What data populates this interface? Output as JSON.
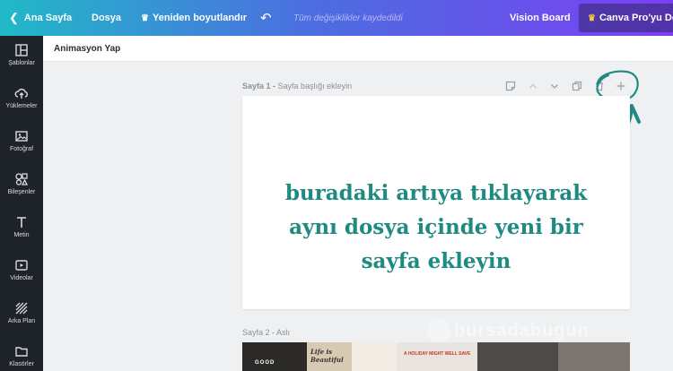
{
  "topbar": {
    "home_label": "Ana Sayfa",
    "file_label": "Dosya",
    "resize_label": "Yeniden boyutlandır",
    "status_text": "Tüm değişiklikler kaydedildi",
    "vision_label": "Vision Board",
    "pro_label": "Canva Pro'yu Den",
    "gradient_start": "#21b9c8",
    "gradient_end": "#7b3ff2"
  },
  "sidebar": {
    "items": [
      {
        "label": "Şablonlar",
        "icon": "layout-icon"
      },
      {
        "label": "Yüklemeler",
        "icon": "upload-cloud-icon"
      },
      {
        "label": "Fotoğraf",
        "icon": "image-icon"
      },
      {
        "label": "Bileşenler",
        "icon": "shapes-icon"
      },
      {
        "label": "Metin",
        "icon": "text-icon"
      },
      {
        "label": "Videolar",
        "icon": "video-icon"
      },
      {
        "label": "Arka Plan",
        "icon": "pattern-icon"
      },
      {
        "label": "Klasörler",
        "icon": "folder-icon"
      }
    ]
  },
  "subbar": {
    "title": "Animasyon Yap"
  },
  "page1": {
    "label_prefix": "Sayfa 1 -",
    "label_hint": "Sayfa başlığı ekleyin",
    "caption_lines": [
      "buradaki artıya tıklayarak",
      "aynı dosya içinde yeni bir",
      "sayfa ekleyin"
    ],
    "caption_color": "#1e8a82"
  },
  "page2": {
    "label": "Sayfa 2 - Aslı",
    "thumbs": [
      "GOOD",
      "Life is Beautiful",
      "",
      "A HOLIDAY MIGHT WELL SAVE",
      "",
      ""
    ]
  },
  "watermark": "bursadabugün"
}
